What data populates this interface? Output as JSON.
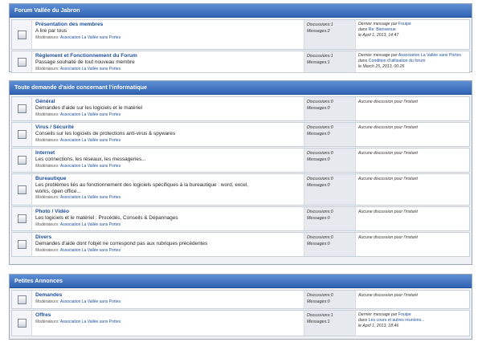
{
  "categories": [
    {
      "title": "Forum Vallée du Jabron",
      "forums": [
        {
          "name": "Présentation des membres",
          "desc": [
            "A lire par tous"
          ],
          "mod_label": "Modérateurs:",
          "mods": "Association La Vallée sans Portes",
          "disc_label": "Discussions:",
          "disc": "1",
          "msg_label": "Messages:",
          "msg": "2",
          "last": {
            "header": "Dernier message par",
            "author": "Fouipe",
            "in": "dans",
            "topic": "Re: Bienvenue",
            "date": "le April 1, 2013, 14:47"
          },
          "h": 38
        },
        {
          "name": "Règlement et Fonctionnement du Forum",
          "desc": [
            "Passage souhaité de tout nouveau membre"
          ],
          "mod_label": "Modérateurs:",
          "mods": "Association La Vallée sans Portes",
          "disc_label": "Discussions:",
          "disc": "1",
          "msg_label": "Messages:",
          "msg": "1",
          "last": {
            "header": "Dernier message par",
            "author": "Association La Vallée sans Portes",
            "in": "dans",
            "topic": "Condition d'utilisation du forum",
            "date": "le March 25, 2013, 00:26"
          },
          "h": 28
        }
      ]
    },
    {
      "title": "Toute demande d'aide concernant l'informatique",
      "forums": [
        {
          "name": "Général",
          "desc": [
            "Demandes d'aide sur les logiciels et le matériel"
          ],
          "mod_label": "Modérateurs:",
          "mods": "Association La Vallée sans Portes",
          "disc_label": "Discussions:",
          "disc": "0",
          "msg_label": "Messages:",
          "msg": "0",
          "none": "Aucune discussion pour l'instant",
          "h": 31
        },
        {
          "name": "Virus / Sécurité",
          "desc": [
            "Conseils sur les logiciels de protections anti-virus & spywares"
          ],
          "mod_label": "Modérateurs:",
          "mods": "Association La Vallée sans Portes",
          "disc_label": "Discussions:",
          "disc": "0",
          "msg_label": "Messages:",
          "msg": "0",
          "none": "Aucune discussion pour l'instant",
          "h": 31
        },
        {
          "name": "Internet",
          "desc": [
            "Les connections, les réseaux, les messageries..."
          ],
          "mod_label": "Modérateurs:",
          "mods": "Association La Vallée sans Portes",
          "disc_label": "Discussions:",
          "disc": "0",
          "msg_label": "Messages:",
          "msg": "0",
          "none": "Aucune discussion pour l'instant",
          "h": 31
        },
        {
          "name": "Bureautique",
          "desc": [
            "Les problèmes liés au fonctionnement des logiciels spécifiques à la bureautique : word, excel,",
            "works, open office..."
          ],
          "mod_label": "Modérateurs:",
          "mods": "Association La Vallée sans Portes",
          "disc_label": "Discussions:",
          "disc": "0",
          "msg_label": "Messages:",
          "msg": "0",
          "none": "Aucune discussion pour l'instant",
          "h": 40
        },
        {
          "name": "Photo / Vidéo",
          "desc": [
            "Les logiciels et le matériel : Procédés, Conseils & Dépannages"
          ],
          "mod_label": "Modérateurs:",
          "mods": "Association La Vallée sans Portes",
          "disc_label": "Discussions:",
          "disc": "0",
          "msg_label": "Messages:",
          "msg": "0",
          "none": "Aucune discussion pour l'instant",
          "h": 31
        },
        {
          "name": "Divers",
          "desc": [
            "Demandes d'aide dont l'objet ne correspond pas aux rubriques précédentes"
          ],
          "mod_label": "Modérateurs:",
          "mods": "Association La Vallée sans Portes",
          "disc_label": "Discussions:",
          "disc": "0",
          "msg_label": "Messages:",
          "msg": "0",
          "none": "Aucune discussion pour l'instant",
          "h": 31
        }
      ]
    },
    {
      "title": "Petites Annonces",
      "forums": [
        {
          "name": "Demandes",
          "desc": [],
          "mod_label": "Modérateurs:",
          "mods": "Association La Vallée sans Portes",
          "disc_label": "Discussions:",
          "disc": "0",
          "msg_label": "Messages:",
          "msg": "0",
          "none": "Aucune discussion pour l'instant",
          "h": 24
        },
        {
          "name": "Offres",
          "desc": [],
          "mod_label": "Modérateurs:",
          "mods": "Association La Vallée sans Portes",
          "disc_label": "Discussions:",
          "disc": "1",
          "msg_label": "Messages:",
          "msg": "1",
          "last": {
            "header": "Dernier message par",
            "author": "Fouipe",
            "in": "dans",
            "topic": "Les cours et autres réunions...",
            "date": "le April 1, 2013, 18:46"
          },
          "h": 33
        }
      ]
    }
  ]
}
